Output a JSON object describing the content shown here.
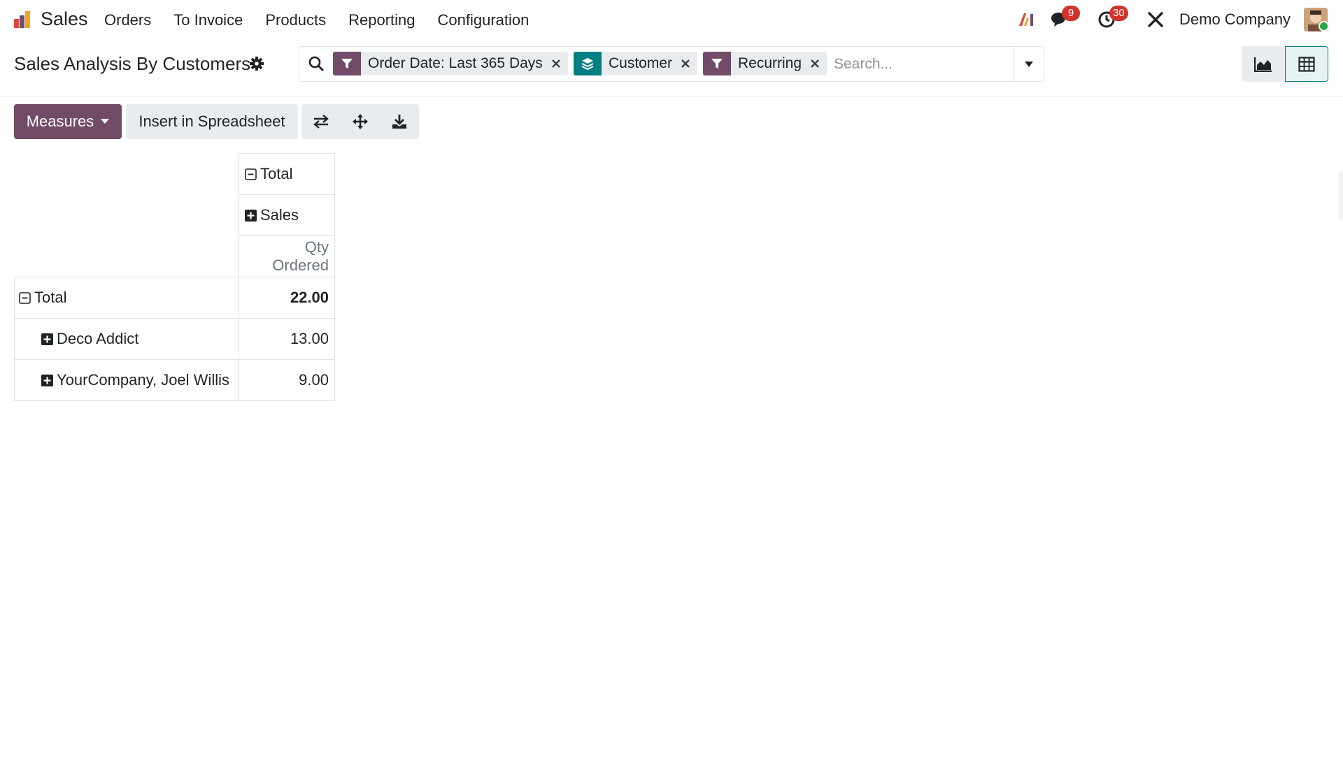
{
  "navbar": {
    "app_name": "Sales",
    "menu": [
      "Orders",
      "To Invoice",
      "Products",
      "Reporting",
      "Configuration"
    ],
    "messages_badge": "9",
    "activities_badge": "30",
    "company": "Demo Company",
    "icons": [
      "sales-app-icon",
      "ai-icon",
      "chat-icon",
      "clock-icon",
      "tools-icon",
      "avatar"
    ]
  },
  "control": {
    "title": "Sales Analysis By Customers",
    "facets": [
      {
        "type": "filter",
        "label": "Order Date: Last 365 Days",
        "color": "#714b67"
      },
      {
        "type": "groupby",
        "label": "Customer",
        "color": "#017e84"
      },
      {
        "type": "filter",
        "label": "Recurring",
        "color": "#714b67"
      }
    ],
    "search_placeholder": "Search...",
    "views": [
      "graph",
      "pivot"
    ],
    "active_view": "pivot"
  },
  "toolbar": {
    "measures_label": "Measures",
    "spreadsheet_label": "Insert in Spreadsheet",
    "icons": [
      "flip-axis-icon",
      "expand-all-icon",
      "download-icon"
    ]
  },
  "pivot": {
    "col_header_total": "Total",
    "col_header_group": "Sales",
    "measure": "Qty Ordered",
    "rows": [
      {
        "label": "Total",
        "value": "22.00",
        "expanded": true,
        "level": 0
      },
      {
        "label": "Deco Addict",
        "value": "13.00",
        "expanded": false,
        "level": 1
      },
      {
        "label": "YourCompany, Joel Willis",
        "value": "9.00",
        "expanded": false,
        "level": 1
      }
    ]
  },
  "colors": {
    "primary": "#714b67",
    "teal": "#017e84",
    "badge": "#d0342c",
    "border": "#dee2e6"
  }
}
